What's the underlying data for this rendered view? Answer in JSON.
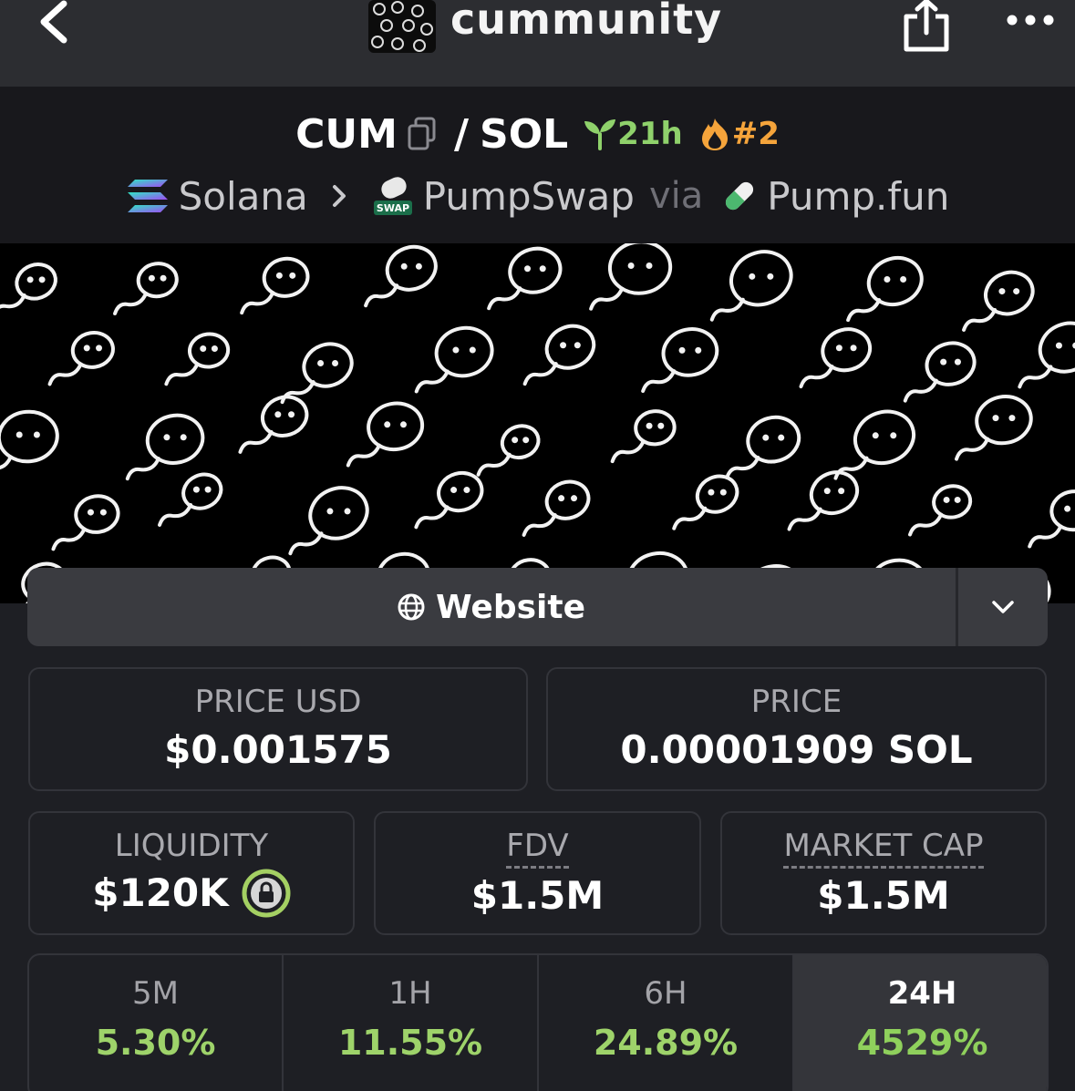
{
  "header": {
    "title": "cummunity"
  },
  "pair": {
    "base": "CUM",
    "separator": "/",
    "quote": "SOL",
    "age": "21h",
    "rank": "#2",
    "chain": "Solana",
    "dex": "PumpSwap",
    "via": "via",
    "launchpad": "Pump.fun"
  },
  "links": {
    "website_label": "Website"
  },
  "stats": {
    "price_usd_label": "PRICE USD",
    "price_usd": "$0.001575",
    "price_label": "PRICE",
    "price": "0.00001909 SOL",
    "liquidity_label": "LIQUIDITY",
    "liquidity": "$120K",
    "fdv_label": "FDV",
    "fdv": "$1.5M",
    "mcap_label": "MARKET CAP",
    "mcap": "$1.5M"
  },
  "timeframes": [
    {
      "label": "5M",
      "change": "5.30%"
    },
    {
      "label": "1H",
      "change": "11.55%"
    },
    {
      "label": "6H",
      "change": "24.89%"
    },
    {
      "label": "24H",
      "change": "4529%",
      "active": true
    }
  ],
  "colors": {
    "positive": "#9ed36a",
    "age_green": "#8fd16b",
    "rank_orange": "#f5a43b",
    "lock_green": "#a4d063"
  },
  "icons": [
    "back-chevron-icon",
    "share-icon",
    "more-dots-icon",
    "copy-icon",
    "sprout-icon",
    "flame-icon",
    "solana-icon",
    "chevron-right-icon",
    "pumpswap-icon",
    "pill-icon",
    "globe-icon",
    "chevron-down-icon",
    "lock-icon"
  ]
}
